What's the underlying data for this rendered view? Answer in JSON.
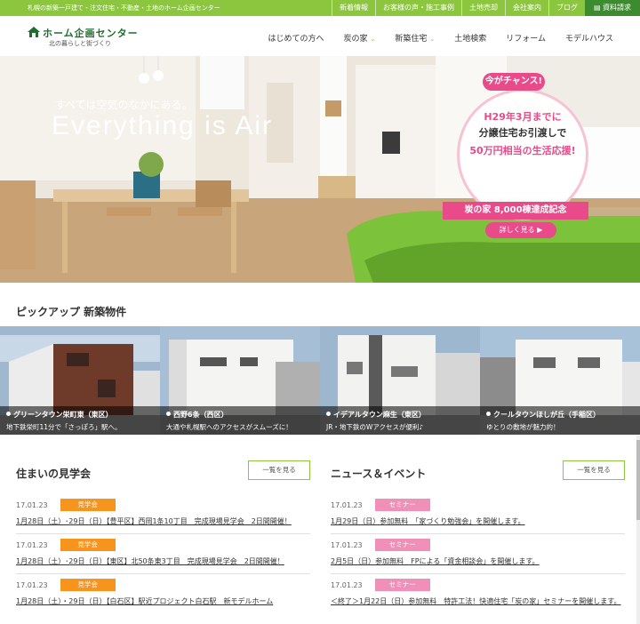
{
  "topbar": {
    "tagline": "札幌の新築一戸建て・注文住宅・不動産・土地のホーム企画センター",
    "links": [
      "新着情報",
      "お客様の声・施工事例",
      "土地売却",
      "会社案内",
      "ブログ"
    ],
    "request_label": "資料請求"
  },
  "logo": {
    "name": "ホーム企画センター",
    "sub": "北の暮らしと街づくり"
  },
  "nav": [
    {
      "label": "はじめての方へ",
      "chevron": false
    },
    {
      "label": "炭の家",
      "chevron": true
    },
    {
      "label": "新築住宅",
      "chevron": true
    },
    {
      "label": "土地検索",
      "chevron": false
    },
    {
      "label": "リフォーム",
      "chevron": false
    },
    {
      "label": "モデルハウス",
      "chevron": false
    }
  ],
  "hero": {
    "subtitle": "すべては空気のなかにある。",
    "title": "Everything is Air"
  },
  "badge": {
    "top": "今がチャンス!",
    "line1": "H29年3月までに",
    "line2": "分譲住宅お引渡しで",
    "line3": "50万円相当の生活応援!",
    "ribbon": "炭の家 8,000棟達成記念",
    "button": "詳しく見る"
  },
  "pickup": {
    "title": "ピックアップ 新築物件",
    "cards": [
      {
        "name": "グリーンタウン栄町東（東区）",
        "desc": "地下鉄栄町11分で「さっぽろ」駅へ。"
      },
      {
        "name": "西野6条（西区）",
        "desc": "大通や札幌駅へのアクセスがスムーズに！"
      },
      {
        "name": "イデアルタウン麻生（東区）",
        "desc": "JR・地下鉄のWアクセスが便利♪"
      },
      {
        "name": "クールタウンほしが丘（手稲区）",
        "desc": "ゆとりの敷地が魅力的！"
      }
    ]
  },
  "events": {
    "title": "住まいの見学会",
    "more": "一覧を見る",
    "items": [
      {
        "date": "17.01.23",
        "tag": "見学会",
        "text": "1月28日（土）･29日（日）【豊平区】西岡1条10丁目　完成現場見学会　2日間開催！"
      },
      {
        "date": "17.01.23",
        "tag": "見学会",
        "text": "1月28日（土）･29日（日）【東区】北50条東3丁目　完成現場見学会　2日間開催！"
      },
      {
        "date": "17.01.23",
        "tag": "見学会",
        "text": "1月28日（土）・29日（日）【白石区】駅近プロジェクト白石駅　新モデルホーム"
      }
    ]
  },
  "news": {
    "title": "ニュース＆イベント",
    "more": "一覧を見る",
    "items": [
      {
        "date": "17.01.23",
        "tag": "セミナー",
        "text": "1月29日（日）参加無料　「家づくり勉強会」を開催します。"
      },
      {
        "date": "17.01.23",
        "tag": "セミナー",
        "text": "2月5日（日）参加無料　FPによる「資金相談会」を開催します。"
      },
      {
        "date": "17.01.23",
        "tag": "セミナー",
        "text": "＜終了＞1月22日（日）参加無料　特許工法！快適住宅「炭の家」セミナーを開催します。"
      }
    ]
  },
  "colors": {
    "accent": "#8cc63f",
    "dark_green": "#3d8b2f",
    "pink": "#e84a8a",
    "orange": "#f7941d"
  }
}
